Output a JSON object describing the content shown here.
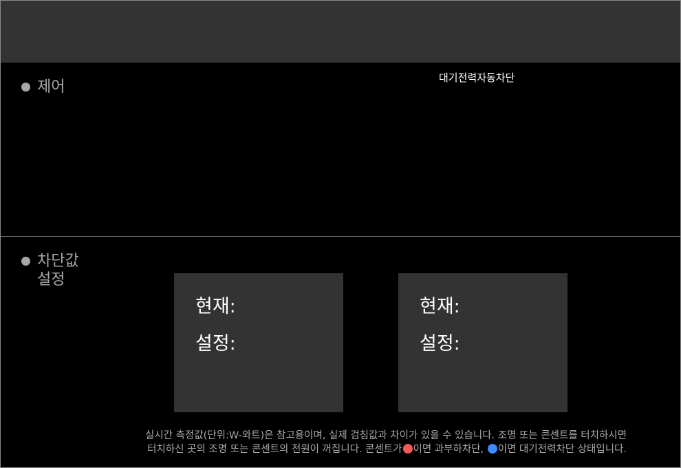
{
  "control": {
    "title": "제어",
    "standby_cutoff_label": "대기전력자동차단"
  },
  "threshold": {
    "title_line1": "차단값",
    "title_line2": "설정",
    "cards": [
      {
        "current_label": "현재:",
        "current_value": "",
        "setting_label": "설정:",
        "setting_value": ""
      },
      {
        "current_label": "현재:",
        "current_value": "",
        "setting_label": "설정:",
        "setting_value": ""
      }
    ]
  },
  "notice": {
    "line1": "실시간 측정값(단위:W-와트)은 참고용이며, 실제 검침값과 차이가 있을 수 있습니다. 조명 또는 콘센트를 터치하시면",
    "line2_a": "터치하신 곳의 조명 또는 콘센트의 전원이 꺼집니다. 콘센트가",
    "line2_b": "이면 과부하차단,",
    "line2_c": "이면 대기전력차단 상태입니다."
  },
  "colors": {
    "overload_dot": "#f25a5a",
    "standby_dot": "#3b8cff",
    "panel": "#333333"
  }
}
